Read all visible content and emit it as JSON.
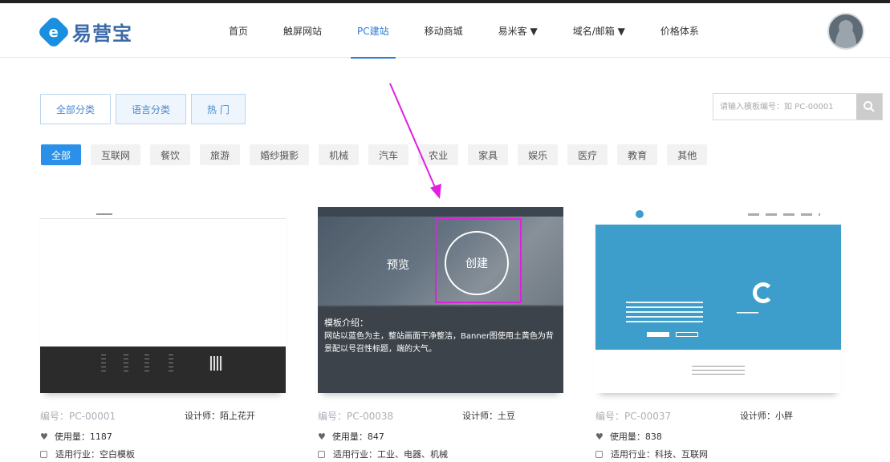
{
  "header": {
    "logo_text": "易营宝",
    "logo_mark": "e",
    "nav": [
      {
        "label": "首页",
        "active": false
      },
      {
        "label": "触屏网站",
        "active": false
      },
      {
        "label": "PC建站",
        "active": true
      },
      {
        "label": "移动商城",
        "active": false
      },
      {
        "label": "易米客 ▼",
        "active": false
      },
      {
        "label": "域名/邮箱 ▼",
        "active": false
      },
      {
        "label": "价格体系",
        "active": false
      }
    ]
  },
  "category_tabs": [
    {
      "label": "全部分类",
      "active": true
    },
    {
      "label": "语言分类",
      "active": false
    },
    {
      "label": "热 门",
      "active": false
    }
  ],
  "search": {
    "placeholder": "请输入模板编号：如 PC-00001"
  },
  "industries": [
    {
      "label": "全部",
      "active": true
    },
    {
      "label": "互联网",
      "active": false
    },
    {
      "label": "餐饮",
      "active": false
    },
    {
      "label": "旅游",
      "active": false
    },
    {
      "label": "婚纱摄影",
      "active": false
    },
    {
      "label": "机械",
      "active": false
    },
    {
      "label": "汽车",
      "active": false
    },
    {
      "label": "农业",
      "active": false
    },
    {
      "label": "家具",
      "active": false
    },
    {
      "label": "娱乐",
      "active": false
    },
    {
      "label": "医疗",
      "active": false
    },
    {
      "label": "教育",
      "active": false
    },
    {
      "label": "其他",
      "active": false
    }
  ],
  "templates": [
    {
      "code": "编号：PC-00001",
      "designer": "设计师：陌上花开",
      "usage": "使用量：1187",
      "industry": "适用行业：空白模板"
    },
    {
      "code": "编号：PC-00038",
      "designer": "设计师：土豆",
      "usage": "使用量：847",
      "industry": "适用行业：工业、电器、机械",
      "preview_label": "预览",
      "create_label": "创建",
      "desc_title": "模板介绍：",
      "desc_text": "网站以蓝色为主，整站画面干净整洁，Banner图使用土黄色为背景配以号召性标题，端的大气。"
    },
    {
      "code": "编号：PC-00037",
      "designer": "设计师：小胖",
      "usage": "使用量：838",
      "industry": "适用行业：科技、互联网"
    }
  ],
  "colors": {
    "accent": "#2b90e8",
    "annotation": "#e020e0"
  }
}
